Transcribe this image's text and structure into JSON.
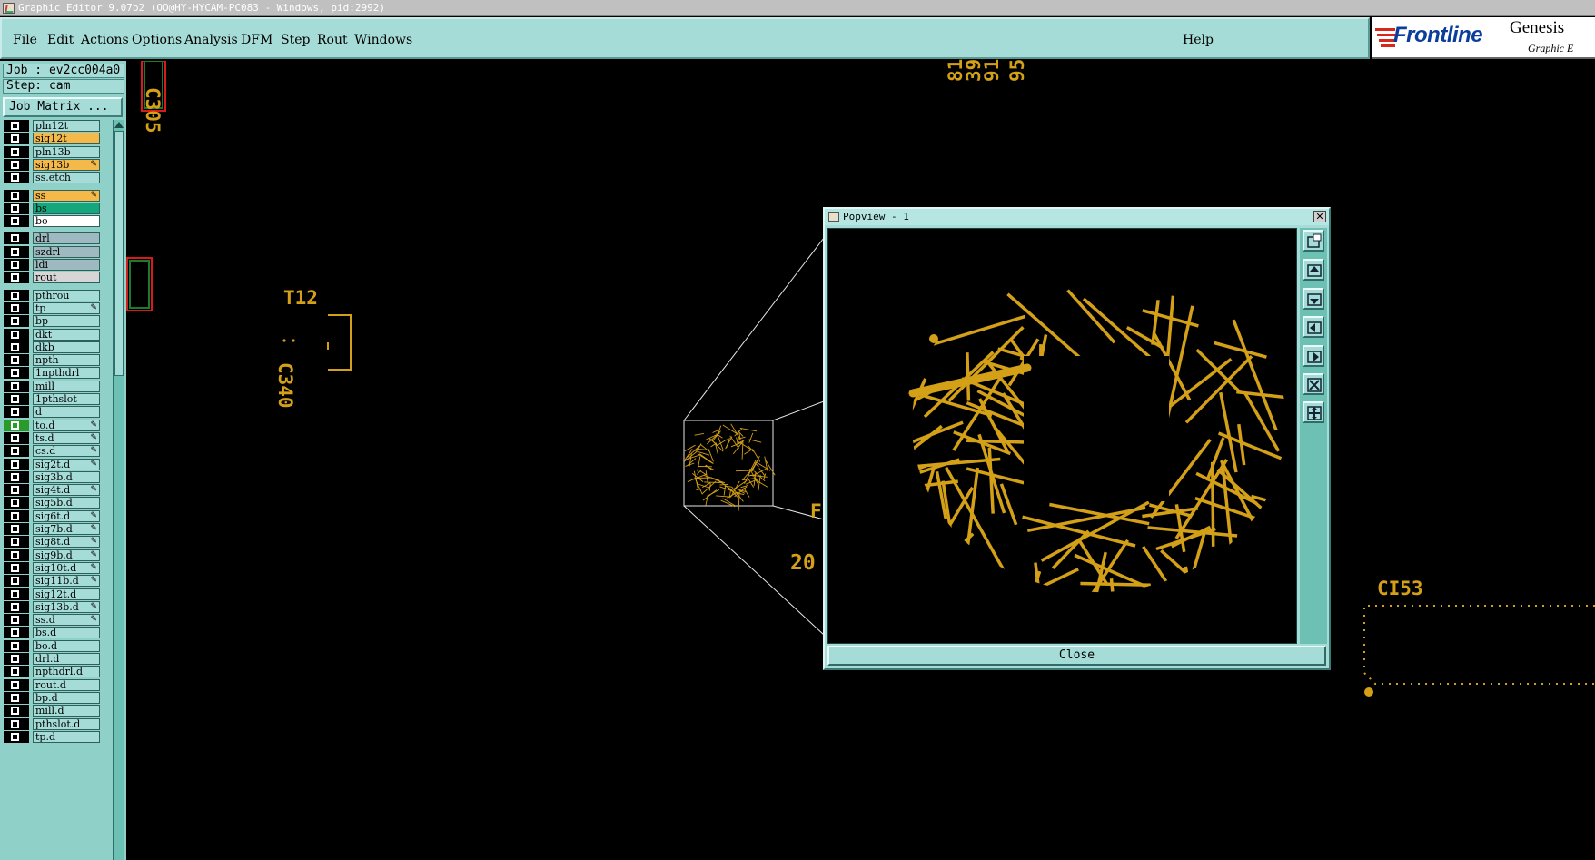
{
  "window": {
    "title": "Graphic Editor 9.07b2 (OO@HY-HYCAM-PC083 - Windows, pid:2992)"
  },
  "menu": {
    "items": [
      "File",
      "Edit",
      "Actions",
      "Options",
      "Analysis",
      "DFM",
      "Step",
      "Rout",
      "Windows"
    ],
    "help": "Help"
  },
  "logo": {
    "brand": "Frontline",
    "product": "Genesis",
    "subtitle": "Graphic E"
  },
  "job": {
    "job_label": "Job : ev2cc004a0",
    "step_label": "Step: cam",
    "matrix_button": "Job Matrix ..."
  },
  "layers": [
    {
      "name": "pln12t",
      "color": "#a6dcd8",
      "editable": false,
      "group": 0
    },
    {
      "name": "sig12t",
      "color": "#f5b94a",
      "editable": false,
      "group": 0
    },
    {
      "name": "pln13b",
      "color": "#a6dcd8",
      "editable": false,
      "group": 0
    },
    {
      "name": "sig13b",
      "color": "#f5b94a",
      "editable": true,
      "group": 0
    },
    {
      "name": "ss.etch",
      "color": "#a6dcd8",
      "editable": false,
      "group": 0
    },
    {
      "name": "ss",
      "color": "#f5b94a",
      "editable": true,
      "group": 1
    },
    {
      "name": "bs",
      "color": "#14a67c",
      "editable": false,
      "group": 1
    },
    {
      "name": "bo",
      "color": "#ffffff",
      "editable": false,
      "group": 1
    },
    {
      "name": "drl",
      "color": "#9fb9c0",
      "editable": false,
      "group": 2
    },
    {
      "name": "szdrl",
      "color": "#9fb9c0",
      "editable": false,
      "group": 2
    },
    {
      "name": "ldi",
      "color": "#9fb9c0",
      "editable": false,
      "group": 2
    },
    {
      "name": "rout",
      "color": "#d6d6d6",
      "editable": false,
      "group": 2
    },
    {
      "name": "pthrou",
      "color": "#a6dcd8",
      "editable": false,
      "group": 3
    },
    {
      "name": "tp",
      "color": "#a6dcd8",
      "editable": true,
      "group": 3
    },
    {
      "name": "bp",
      "color": "#a6dcd8",
      "editable": false,
      "group": 3
    },
    {
      "name": "dkt",
      "color": "#a6dcd8",
      "editable": false,
      "group": 3
    },
    {
      "name": "dkb",
      "color": "#a6dcd8",
      "editable": false,
      "group": 3
    },
    {
      "name": "npth",
      "color": "#a6dcd8",
      "editable": false,
      "group": 3
    },
    {
      "name": "1npthdrl",
      "color": "#a6dcd8",
      "editable": false,
      "group": 3
    },
    {
      "name": "mill",
      "color": "#a6dcd8",
      "editable": false,
      "group": 3
    },
    {
      "name": "1pthslot",
      "color": "#a6dcd8",
      "editable": false,
      "group": 3
    },
    {
      "name": "d",
      "color": "#a6dcd8",
      "editable": false,
      "group": 3
    },
    {
      "name": "to.d",
      "color": "#a6dcd8",
      "editable": true,
      "group": 3,
      "active": true
    },
    {
      "name": "ts.d",
      "color": "#a6dcd8",
      "editable": true,
      "group": 3
    },
    {
      "name": "cs.d",
      "color": "#a6dcd8",
      "editable": true,
      "group": 3
    },
    {
      "name": "sig2t.d",
      "color": "#a6dcd8",
      "editable": true,
      "group": 3
    },
    {
      "name": "sig3b.d",
      "color": "#a6dcd8",
      "editable": false,
      "group": 3
    },
    {
      "name": "sig4t.d",
      "color": "#a6dcd8",
      "editable": true,
      "group": 3
    },
    {
      "name": "sig5b.d",
      "color": "#a6dcd8",
      "editable": false,
      "group": 3
    },
    {
      "name": "sig6t.d",
      "color": "#a6dcd8",
      "editable": true,
      "group": 3
    },
    {
      "name": "sig7b.d",
      "color": "#a6dcd8",
      "editable": true,
      "group": 3
    },
    {
      "name": "sig8t.d",
      "color": "#a6dcd8",
      "editable": true,
      "group": 3
    },
    {
      "name": "sig9b.d",
      "color": "#a6dcd8",
      "editable": true,
      "group": 3
    },
    {
      "name": "sig10t.d",
      "color": "#a6dcd8",
      "editable": true,
      "group": 3
    },
    {
      "name": "sig11b.d",
      "color": "#a6dcd8",
      "editable": true,
      "group": 3
    },
    {
      "name": "sig12t.d",
      "color": "#a6dcd8",
      "editable": false,
      "group": 3
    },
    {
      "name": "sig13b.d",
      "color": "#a6dcd8",
      "editable": true,
      "group": 3
    },
    {
      "name": "ss.d",
      "color": "#a6dcd8",
      "editable": true,
      "group": 3
    },
    {
      "name": "bs.d",
      "color": "#a6dcd8",
      "editable": false,
      "group": 3
    },
    {
      "name": "bo.d",
      "color": "#a6dcd8",
      "editable": false,
      "group": 3
    },
    {
      "name": "drl.d",
      "color": "#a6dcd8",
      "editable": false,
      "group": 3
    },
    {
      "name": "npthdrl.d",
      "color": "#a6dcd8",
      "editable": false,
      "group": 3
    },
    {
      "name": "rout.d",
      "color": "#a6dcd8",
      "editable": false,
      "group": 3
    },
    {
      "name": "bp.d",
      "color": "#a6dcd8",
      "editable": false,
      "group": 3
    },
    {
      "name": "mill.d",
      "color": "#a6dcd8",
      "editable": false,
      "group": 3
    },
    {
      "name": "pthslot.d",
      "color": "#a6dcd8",
      "editable": false,
      "group": 3
    },
    {
      "name": "tp.d",
      "color": "#a6dcd8",
      "editable": false,
      "group": 3
    }
  ],
  "canvas": {
    "labels": {
      "c305": "C305",
      "t12": "T12",
      "c340": "C340",
      "top_nums": [
        "81",
        "39",
        "91",
        "95"
      ],
      "f_partial": "F",
      "num_20": "20",
      "ci53": "CI53"
    },
    "trace_color": "#d4a017"
  },
  "popview": {
    "title": "Popview - 1",
    "close_button": "Close",
    "tools": [
      "zoom-fit-icon",
      "pan-up-icon",
      "pan-down-icon",
      "pan-left-icon",
      "pan-right-icon",
      "zoom-in-icon",
      "zoom-out-icon"
    ]
  }
}
